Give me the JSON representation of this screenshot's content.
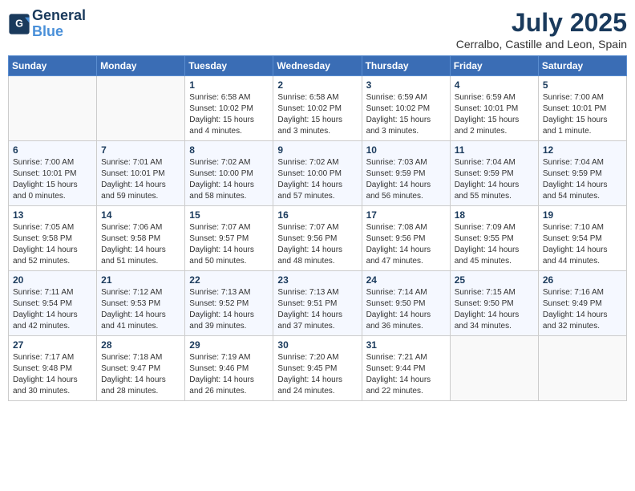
{
  "header": {
    "logo_line1": "General",
    "logo_line2": "Blue",
    "month": "July 2025",
    "location": "Cerralbo, Castille and Leon, Spain"
  },
  "weekdays": [
    "Sunday",
    "Monday",
    "Tuesday",
    "Wednesday",
    "Thursday",
    "Friday",
    "Saturday"
  ],
  "weeks": [
    [
      {
        "day": "",
        "info": ""
      },
      {
        "day": "",
        "info": ""
      },
      {
        "day": "1",
        "info": "Sunrise: 6:58 AM\nSunset: 10:02 PM\nDaylight: 15 hours\nand 4 minutes."
      },
      {
        "day": "2",
        "info": "Sunrise: 6:58 AM\nSunset: 10:02 PM\nDaylight: 15 hours\nand 3 minutes."
      },
      {
        "day": "3",
        "info": "Sunrise: 6:59 AM\nSunset: 10:02 PM\nDaylight: 15 hours\nand 3 minutes."
      },
      {
        "day": "4",
        "info": "Sunrise: 6:59 AM\nSunset: 10:01 PM\nDaylight: 15 hours\nand 2 minutes."
      },
      {
        "day": "5",
        "info": "Sunrise: 7:00 AM\nSunset: 10:01 PM\nDaylight: 15 hours\nand 1 minute."
      }
    ],
    [
      {
        "day": "6",
        "info": "Sunrise: 7:00 AM\nSunset: 10:01 PM\nDaylight: 15 hours\nand 0 minutes."
      },
      {
        "day": "7",
        "info": "Sunrise: 7:01 AM\nSunset: 10:01 PM\nDaylight: 14 hours\nand 59 minutes."
      },
      {
        "day": "8",
        "info": "Sunrise: 7:02 AM\nSunset: 10:00 PM\nDaylight: 14 hours\nand 58 minutes."
      },
      {
        "day": "9",
        "info": "Sunrise: 7:02 AM\nSunset: 10:00 PM\nDaylight: 14 hours\nand 57 minutes."
      },
      {
        "day": "10",
        "info": "Sunrise: 7:03 AM\nSunset: 9:59 PM\nDaylight: 14 hours\nand 56 minutes."
      },
      {
        "day": "11",
        "info": "Sunrise: 7:04 AM\nSunset: 9:59 PM\nDaylight: 14 hours\nand 55 minutes."
      },
      {
        "day": "12",
        "info": "Sunrise: 7:04 AM\nSunset: 9:59 PM\nDaylight: 14 hours\nand 54 minutes."
      }
    ],
    [
      {
        "day": "13",
        "info": "Sunrise: 7:05 AM\nSunset: 9:58 PM\nDaylight: 14 hours\nand 52 minutes."
      },
      {
        "day": "14",
        "info": "Sunrise: 7:06 AM\nSunset: 9:58 PM\nDaylight: 14 hours\nand 51 minutes."
      },
      {
        "day": "15",
        "info": "Sunrise: 7:07 AM\nSunset: 9:57 PM\nDaylight: 14 hours\nand 50 minutes."
      },
      {
        "day": "16",
        "info": "Sunrise: 7:07 AM\nSunset: 9:56 PM\nDaylight: 14 hours\nand 48 minutes."
      },
      {
        "day": "17",
        "info": "Sunrise: 7:08 AM\nSunset: 9:56 PM\nDaylight: 14 hours\nand 47 minutes."
      },
      {
        "day": "18",
        "info": "Sunrise: 7:09 AM\nSunset: 9:55 PM\nDaylight: 14 hours\nand 45 minutes."
      },
      {
        "day": "19",
        "info": "Sunrise: 7:10 AM\nSunset: 9:54 PM\nDaylight: 14 hours\nand 44 minutes."
      }
    ],
    [
      {
        "day": "20",
        "info": "Sunrise: 7:11 AM\nSunset: 9:54 PM\nDaylight: 14 hours\nand 42 minutes."
      },
      {
        "day": "21",
        "info": "Sunrise: 7:12 AM\nSunset: 9:53 PM\nDaylight: 14 hours\nand 41 minutes."
      },
      {
        "day": "22",
        "info": "Sunrise: 7:13 AM\nSunset: 9:52 PM\nDaylight: 14 hours\nand 39 minutes."
      },
      {
        "day": "23",
        "info": "Sunrise: 7:13 AM\nSunset: 9:51 PM\nDaylight: 14 hours\nand 37 minutes."
      },
      {
        "day": "24",
        "info": "Sunrise: 7:14 AM\nSunset: 9:50 PM\nDaylight: 14 hours\nand 36 minutes."
      },
      {
        "day": "25",
        "info": "Sunrise: 7:15 AM\nSunset: 9:50 PM\nDaylight: 14 hours\nand 34 minutes."
      },
      {
        "day": "26",
        "info": "Sunrise: 7:16 AM\nSunset: 9:49 PM\nDaylight: 14 hours\nand 32 minutes."
      }
    ],
    [
      {
        "day": "27",
        "info": "Sunrise: 7:17 AM\nSunset: 9:48 PM\nDaylight: 14 hours\nand 30 minutes."
      },
      {
        "day": "28",
        "info": "Sunrise: 7:18 AM\nSunset: 9:47 PM\nDaylight: 14 hours\nand 28 minutes."
      },
      {
        "day": "29",
        "info": "Sunrise: 7:19 AM\nSunset: 9:46 PM\nDaylight: 14 hours\nand 26 minutes."
      },
      {
        "day": "30",
        "info": "Sunrise: 7:20 AM\nSunset: 9:45 PM\nDaylight: 14 hours\nand 24 minutes."
      },
      {
        "day": "31",
        "info": "Sunrise: 7:21 AM\nSunset: 9:44 PM\nDaylight: 14 hours\nand 22 minutes."
      },
      {
        "day": "",
        "info": ""
      },
      {
        "day": "",
        "info": ""
      }
    ]
  ]
}
